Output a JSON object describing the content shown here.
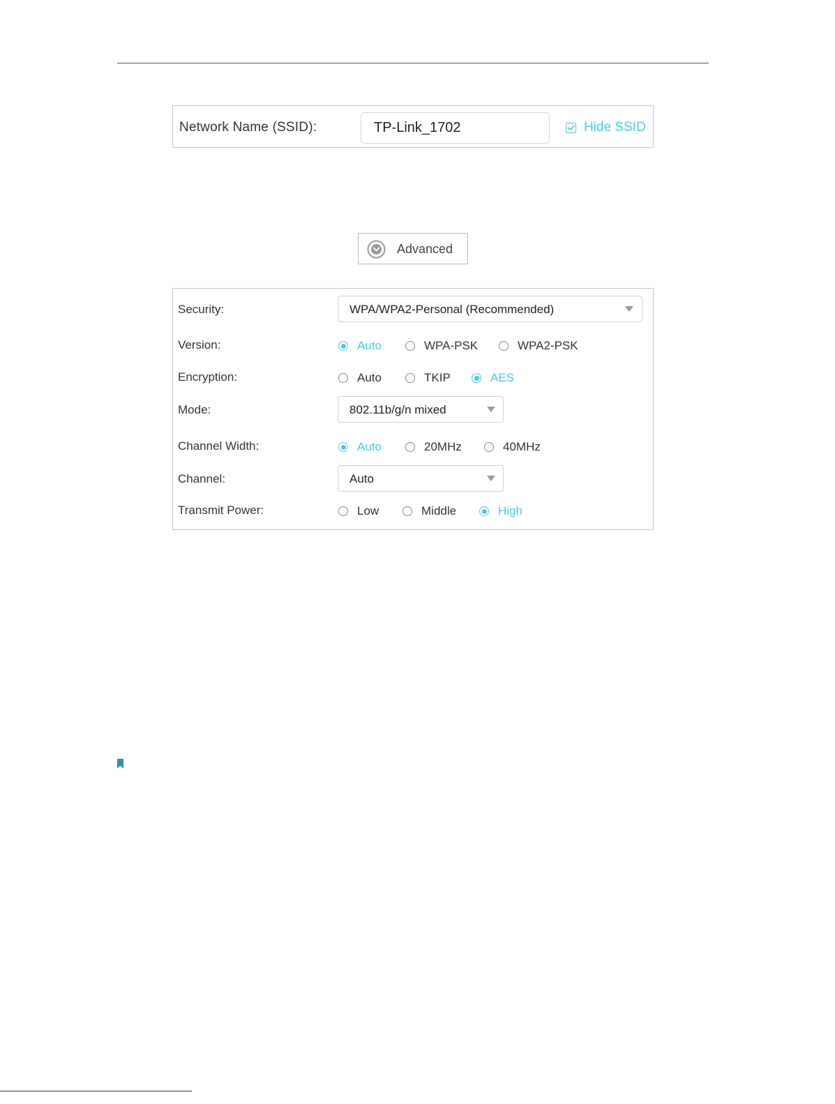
{
  "ssid": {
    "label": "Network Name (SSID):",
    "value": "TP-Link_1702",
    "hide_ssid_label": "Hide SSID",
    "hide_ssid_checked": true
  },
  "advanced": {
    "label": "Advanced",
    "icon": "chevron-down-circle-icon"
  },
  "settings": {
    "security": {
      "label": "Security:",
      "value": "WPA/WPA2-Personal (Recommended)"
    },
    "version": {
      "label": "Version:",
      "options": [
        "Auto",
        "WPA-PSK",
        "WPA2-PSK"
      ],
      "selected": "Auto"
    },
    "encryption": {
      "label": "Encryption:",
      "options": [
        "Auto",
        "TKIP",
        "AES"
      ],
      "selected": "AES"
    },
    "mode": {
      "label": "Mode:",
      "value": "802.11b/g/n mixed"
    },
    "channel_width": {
      "label": "Channel Width:",
      "options": [
        "Auto",
        "20MHz",
        "40MHz"
      ],
      "selected": "Auto"
    },
    "channel": {
      "label": "Channel:",
      "value": "Auto"
    },
    "transmit_power": {
      "label": "Transmit Power:",
      "options": [
        "Low",
        "Middle",
        "High"
      ],
      "selected": "High"
    }
  },
  "colors": {
    "accent": "#4acbd6",
    "note_marker": "#3a8fa3",
    "border": "#c9c9c9"
  }
}
